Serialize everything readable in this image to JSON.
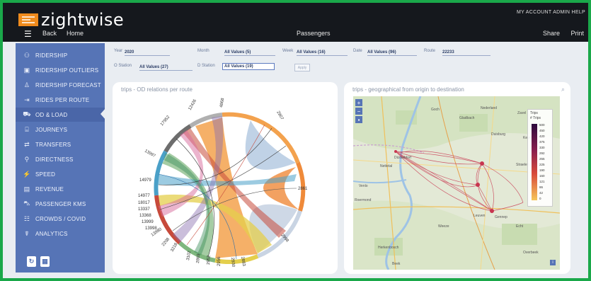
{
  "app": {
    "logo_text": "zightwise",
    "page_title": "Passengers"
  },
  "topnav": {
    "menu_icon": "hamburger-icon",
    "back": "Back",
    "home": "Home",
    "account": "MY ACCOUNT  ADMIN  HELP",
    "share": "Share",
    "print": "Print"
  },
  "sidebar": {
    "items": [
      {
        "label": "RIDERSHIP",
        "icon": "ridership-icon"
      },
      {
        "label": "RIDERSHIP OUTLIERS",
        "icon": "outliers-icon"
      },
      {
        "label": "RIDERSHIP FORECAST",
        "icon": "forecast-icon"
      },
      {
        "label": "RIDES PER ROUTE",
        "icon": "route-sign-icon"
      },
      {
        "label": "OD & LOAD",
        "icon": "od-load-icon"
      },
      {
        "label": "JOURNEYS",
        "icon": "journeys-icon"
      },
      {
        "label": "TRANSFERS",
        "icon": "transfers-icon"
      },
      {
        "label": "DIRECTNESS",
        "icon": "directness-icon"
      },
      {
        "label": "SPEED",
        "icon": "speed-icon"
      },
      {
        "label": "REVENUE",
        "icon": "revenue-icon"
      },
      {
        "label": "PASSENGER KMS",
        "icon": "bus-icon"
      },
      {
        "label": "CROWDS / COVID",
        "icon": "crowds-icon"
      },
      {
        "label": "ANALYTICS",
        "icon": "analytics-icon"
      }
    ],
    "active_index": 4
  },
  "filters": {
    "year_label": "Year",
    "year_value": "2020",
    "month_label": "Month",
    "month_value": "All Values (5)",
    "week_label": "Week",
    "week_value": "All Values (16)",
    "date_label": "Date",
    "date_value": "All Values (96)",
    "route_label": "Route",
    "route_value": "22233",
    "o_station_label": "O Station",
    "o_station_value": "All Values (27)",
    "d_station_label": "D Station",
    "d_station_value": "All Values (19)",
    "apply_label": "Apply"
  },
  "chord_panel": {
    "title": "trips - OD relations per route",
    "labels": [
      "12426",
      "4868",
      "2907",
      "17952",
      "13997",
      "14979",
      "14977",
      "18017",
      "13337",
      "13368",
      "13999",
      "13998",
      "13980",
      "2208",
      "3218",
      "3102",
      "2869",
      "2952",
      "2956",
      "2930",
      "2883",
      "2998",
      "2861"
    ]
  },
  "map_panel": {
    "title": "trips - geographical from origin to destination",
    "legend_title": "Trips",
    "legend_subtitle": "# Trips",
    "legend_values": [
      "500",
      "450",
      "420",
      "375",
      "330",
      "292",
      "255",
      "225",
      "190",
      "160",
      "121",
      "86",
      "42",
      "0"
    ],
    "places": [
      "Nederland",
      "Zavel",
      "Gladbach",
      "Duisburg",
      "Düsseldorf",
      "Nettetal",
      "Venlo",
      "Roermond",
      "Leuven",
      "Gennep",
      "Echt",
      "Herkenbosch",
      "Beek",
      "Overbeek",
      "Goch",
      "Straelen",
      "Weeze",
      "Kevelaer"
    ]
  }
}
